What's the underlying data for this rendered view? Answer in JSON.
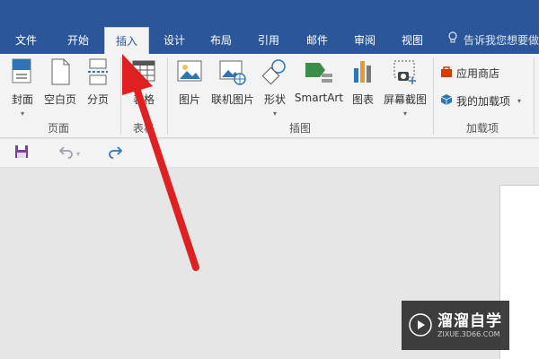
{
  "ribbon_tabs": [
    {
      "label": "文件"
    },
    {
      "label": "开始"
    },
    {
      "label": "插入"
    },
    {
      "label": "设计"
    },
    {
      "label": "布局"
    },
    {
      "label": "引用"
    },
    {
      "label": "邮件"
    },
    {
      "label": "审阅"
    },
    {
      "label": "视图"
    }
  ],
  "active_tab": "插入",
  "tell_me": {
    "text": "告诉我您想要做"
  },
  "groups": {
    "pages": {
      "label": "页面",
      "buttons": {
        "cover": {
          "label": "封面",
          "icon": "cover-page-icon"
        },
        "blank": {
          "label": "空白页",
          "icon": "blank-page-icon"
        },
        "pagebreak": {
          "label": "分页",
          "icon": "page-break-icon"
        }
      }
    },
    "tables": {
      "label": "表格",
      "button": {
        "label": "表格",
        "icon": "table-icon"
      }
    },
    "illustrations": {
      "label": "插图",
      "buttons": {
        "pictures": {
          "label": "图片",
          "icon": "picture-icon"
        },
        "online": {
          "label": "联机图片",
          "icon": "online-picture-icon"
        },
        "shapes": {
          "label": "形状",
          "icon": "shapes-icon"
        },
        "smartart": {
          "label": "SmartArt",
          "icon": "smartart-icon"
        },
        "chart": {
          "label": "图表",
          "icon": "chart-icon"
        },
        "screenshot": {
          "label": "屏幕截图",
          "icon": "screenshot-icon"
        }
      }
    },
    "addins": {
      "label": "加载项",
      "store": {
        "label": "应用商店",
        "icon": "store-icon"
      },
      "my_addins": {
        "label": "我的加载项",
        "icon": "my-addins-icon"
      }
    }
  },
  "quick_access": {
    "save": "save-icon",
    "undo": "undo-icon",
    "redo": "redo-icon"
  },
  "watermark": {
    "title": "溜溜自学",
    "subtitle": "ZIXUE.3D66.COM"
  },
  "colors": {
    "brand_blue": "#2b579a",
    "ribbon_bg": "#f3f3f3",
    "arrow_red": "#e02020"
  }
}
